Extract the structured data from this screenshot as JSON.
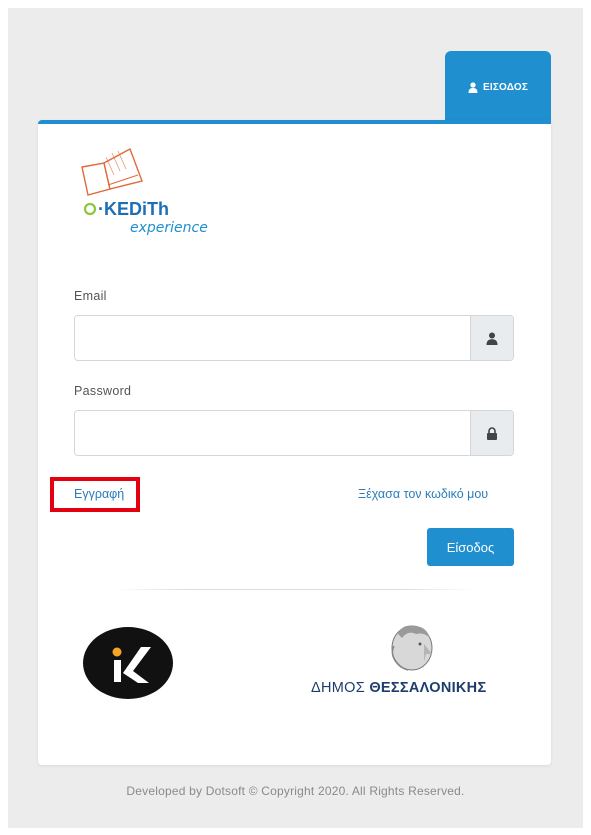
{
  "tab": {
    "label": "ΕΙΣΟΔΟΣ"
  },
  "logo": {
    "brand": "e-KEDiTh",
    "sub": "experience"
  },
  "form": {
    "email_label": "Email",
    "email_value": "",
    "password_label": "Password",
    "password_value": ""
  },
  "links": {
    "register": "Εγγραφή",
    "forgot": "Ξέχασα τον κωδικό μου"
  },
  "buttons": {
    "login": "Είσοδος"
  },
  "partners": {
    "municipality_prefix": "ΔΗΜΟΣ",
    "municipality_name": "ΘΕΣΣΑΛΟΝΙΚΗΣ"
  },
  "footer": {
    "text": "Developed by Dotsoft © Copyright 2020. All Rights Reserved."
  },
  "colors": {
    "accent": "#1f8fd0",
    "highlight": "#e3000f",
    "muni_text": "#1d3d6b"
  }
}
